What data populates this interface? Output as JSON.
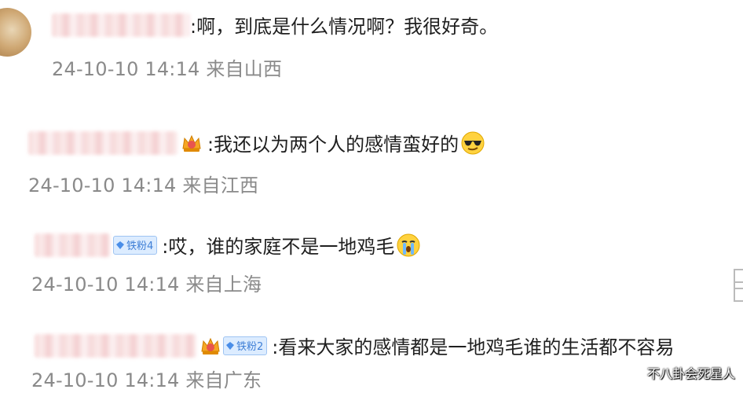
{
  "comments": [
    {
      "text": ":啊，到底是什么情况啊？我很好奇。",
      "meta": "24-10-10 14:14 来自山西"
    },
    {
      "text": ":我还以为两个人的感情蛮好的",
      "meta": "24-10-10 14:14 来自江西",
      "emoji": "sunglasses-emoji"
    },
    {
      "badge": "铁粉4",
      "text": ":哎，谁的家庭不是一地鸡毛",
      "meta": "24-10-10 14:14 来自上海",
      "emoji": "crying-emoji"
    },
    {
      "badge": "铁粉2",
      "text": ":看来大家的感情都是一地鸡毛谁的生活都不容易",
      "meta": "24-10-10 14:14 来自广东"
    }
  ],
  "watermark": "不八卦会死星人",
  "colors": {
    "meta": "#8a8a8a",
    "badge_bg": "#dcecff",
    "badge_text": "#3f7fd6"
  }
}
